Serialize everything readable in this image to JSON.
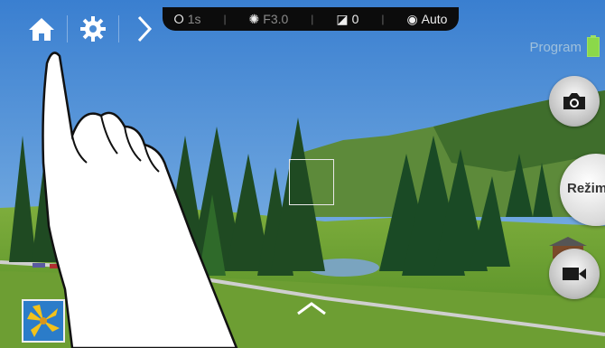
{
  "status": {
    "timer": "1s",
    "aperture": "F3.0",
    "exposure": "0",
    "iso": "Auto"
  },
  "mode": {
    "name": "Program",
    "mode_button_label": "Režim"
  },
  "icons": [
    "home-icon",
    "gear-icon",
    "chevron-right-icon",
    "camera-icon",
    "video-camera-icon",
    "chevron-up-icon",
    "gallery-icon"
  ],
  "colors": {
    "battery": "#8bd84a",
    "mode_text": "#9fc0dc",
    "statusbar": "#0c0c0c"
  }
}
